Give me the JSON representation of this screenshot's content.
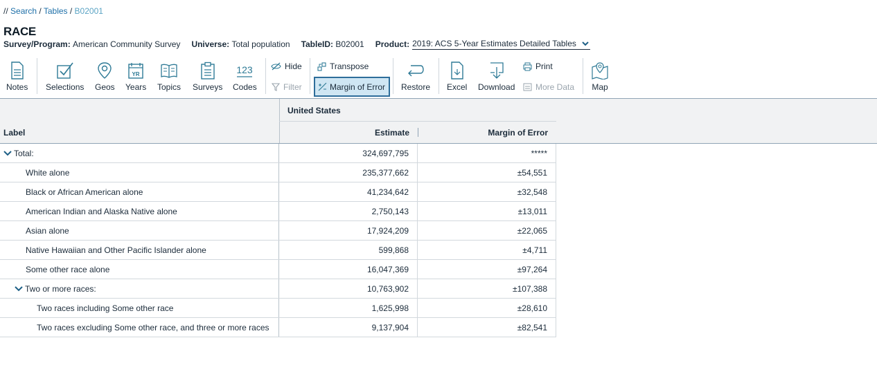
{
  "breadcrumb": {
    "prefix": "// ",
    "items": [
      "Search",
      "Tables"
    ],
    "current": "B02001"
  },
  "title": "RACE",
  "meta": {
    "survey_label": "Survey/Program:",
    "survey_value": "American Community Survey",
    "universe_label": "Universe:",
    "universe_value": "Total population",
    "tableid_label": "TableID:",
    "tableid_value": "B02001",
    "product_label": "Product:",
    "product_value": "2019: ACS 5-Year Estimates Detailed Tables"
  },
  "toolbar": {
    "notes": "Notes",
    "selections": "Selections",
    "geos": "Geos",
    "years": "Years",
    "topics": "Topics",
    "surveys": "Surveys",
    "codes": "Codes",
    "codes_icon_text": "123",
    "years_icon_text": "YR",
    "hide": "Hide",
    "filter": "Filter",
    "transpose": "Transpose",
    "margin_of_error": "Margin of Error",
    "restore": "Restore",
    "excel": "Excel",
    "download": "Download",
    "print": "Print",
    "more_data": "More Data",
    "map": "Map"
  },
  "table": {
    "geo_header": "United States",
    "label_header": "Label",
    "estimate_header": "Estimate",
    "moe_header": "Margin of Error",
    "rows": [
      {
        "label": "Total:",
        "estimate": "324,697,795",
        "moe": "*****"
      },
      {
        "label": "White alone",
        "estimate": "235,377,662",
        "moe": "±54,551"
      },
      {
        "label": "Black or African American alone",
        "estimate": "41,234,642",
        "moe": "±32,548"
      },
      {
        "label": "American Indian and Alaska Native alone",
        "estimate": "2,750,143",
        "moe": "±13,011"
      },
      {
        "label": "Asian alone",
        "estimate": "17,924,209",
        "moe": "±22,065"
      },
      {
        "label": "Native Hawaiian and Other Pacific Islander alone",
        "estimate": "599,868",
        "moe": "±4,711"
      },
      {
        "label": "Some other race alone",
        "estimate": "16,047,369",
        "moe": "±97,264"
      },
      {
        "label": "Two or more races:",
        "estimate": "10,763,902",
        "moe": "±107,388"
      },
      {
        "label": "Two races including Some other race",
        "estimate": "1,625,998",
        "moe": "±28,610"
      },
      {
        "label": "Two races excluding Some other race, and three or more races",
        "estimate": "9,137,904",
        "moe": "±82,541"
      }
    ]
  },
  "colors": {
    "link": "#1d6fa8",
    "accent": "#2d6d9a",
    "selected_bg": "#cfe6f3",
    "icon": "#2e7a96"
  }
}
